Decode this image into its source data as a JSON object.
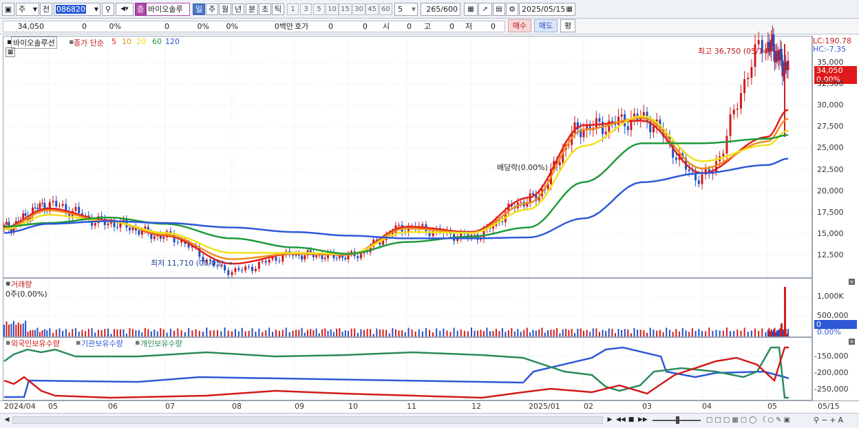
{
  "toolbar": {
    "market": "주",
    "prev": "전",
    "code": "086820",
    "grade_badge": "증",
    "stock_name": "바이오솔루",
    "periods": [
      "일",
      "주",
      "월",
      "년",
      "분",
      "초",
      "틱"
    ],
    "active_period": "일",
    "intervals": [
      "1",
      "3",
      "5",
      "10",
      "15",
      "30",
      "45",
      "60"
    ],
    "interval_value": "5",
    "count": "265",
    "count_max": "/600",
    "date": "2025/05/15"
  },
  "info": {
    "price": "34,050",
    "change": "0",
    "change_pct": "0%",
    "volume": "0",
    "vol_pct": "0%",
    "vol_pct2": "0%",
    "amount": "0백만",
    "hoga_label": "호가",
    "hoga1": "0",
    "hoga2": "0",
    "open_label": "시",
    "open": "0",
    "high_label": "고",
    "high": "0",
    "low_label": "저",
    "low": "0",
    "buy": "매수",
    "sell": "매도",
    "avg": "평"
  },
  "price_panel": {
    "name_box": "바이오솔루션",
    "legend_prefix": "종가 단순",
    "ma_labels": [
      "5",
      "10",
      "20",
      "60",
      "120"
    ],
    "ma_colors": [
      "#e0201b",
      "#f08c1c",
      "#f0e21a",
      "#1f9a3a",
      "#2e58d8"
    ],
    "lc": "LC:190.78",
    "hc": "HC:-7.35",
    "current_tag": "34,050",
    "pct_tag": "0.00%",
    "high_note": "최고 36,750 (05/14)",
    "low_note": "최저 11,710 (08/05)",
    "dividend_note": "배당락(0.00%)",
    "y_ticks": [
      "35,000",
      "32,500",
      "30,000",
      "27,500",
      "25,000",
      "22,500",
      "20,000",
      "17,500",
      "15,000",
      "12,500"
    ]
  },
  "volume_panel": {
    "title": "거래량",
    "sub": "0주(0.00%)",
    "y_ticks": [
      "1,000K",
      "500,000"
    ],
    "zero_tag": "0",
    "pct_tag": "0.00%"
  },
  "holder_panel": {
    "series": [
      "외국인보유수량",
      "기관보유수량",
      "개인보유수량"
    ],
    "series_colors": [
      "#d21a1a",
      "#2e58d8",
      "#2a8a5a"
    ],
    "y_ticks": [
      "-150,000",
      "-200,000",
      "-250,000"
    ]
  },
  "x_axis": {
    "labels": [
      "2024/04",
      "05",
      "06",
      "07",
      "08",
      "09",
      "10",
      "11",
      "12",
      "2025/01",
      "02",
      "03",
      "04",
      "05",
      "05/15"
    ]
  },
  "chart_data": {
    "type": "line",
    "title": "바이오솔루션 일봉",
    "xlabel": "",
    "ylabel": "",
    "x_range": [
      "2024/04",
      "2025/05/15"
    ],
    "ylim": [
      11000,
      37000
    ],
    "close_approx": {
      "x": [
        "2024/04",
        "05",
        "06",
        "07",
        "08/05",
        "09",
        "10",
        "11",
        "12",
        "2025/01",
        "02",
        "03",
        "04",
        "05/14",
        "05/15"
      ],
      "values": [
        16500,
        19000,
        17000,
        15500,
        11710,
        13500,
        13300,
        16500,
        15500,
        19500,
        27500,
        28500,
        22000,
        36750,
        34050
      ]
    },
    "series": [
      {
        "name": "5",
        "values": [
          16500,
          18600,
          17300,
          15600,
          12500,
          13600,
          13500,
          16600,
          16000,
          19800,
          27800,
          28300,
          22500,
          26500,
          29500
        ]
      },
      {
        "name": "10",
        "values": [
          16400,
          18400,
          17200,
          15700,
          13000,
          13600,
          13500,
          16400,
          15900,
          19200,
          27300,
          28600,
          23000,
          26000,
          28500
        ]
      },
      {
        "name": "20",
        "values": [
          16300,
          17900,
          17200,
          15900,
          13700,
          13700,
          13600,
          16000,
          15900,
          18500,
          25500,
          28800,
          23800,
          25600,
          27200
        ]
      },
      {
        "name": "60",
        "values": [
          16600,
          17000,
          17600,
          16900,
          15300,
          14300,
          13600,
          14900,
          15500,
          16500,
          21500,
          25800,
          25800,
          26300,
          26700
        ]
      },
      {
        "name": "120",
        "values": [
          15900,
          16900,
          17200,
          17000,
          16500,
          16000,
          15600,
          15300,
          15300,
          15400,
          17500,
          21500,
          22500,
          23400,
          24100
        ]
      }
    ]
  }
}
